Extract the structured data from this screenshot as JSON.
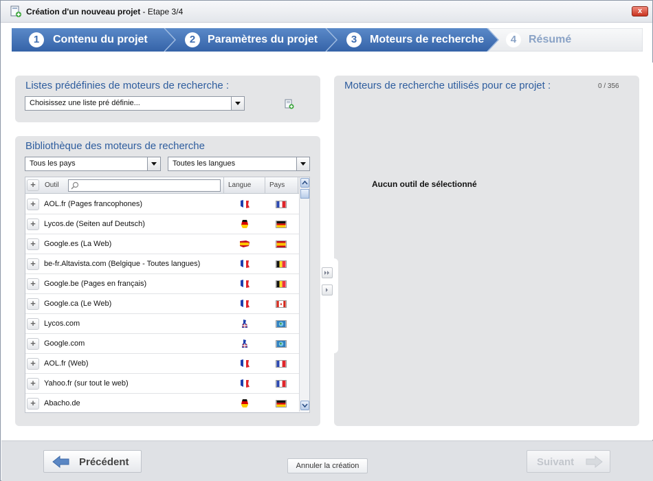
{
  "window": {
    "title_bold": "Création d'un nouveau projet",
    "title_rest": " - Etape 3/4",
    "close_label": "x"
  },
  "steps": [
    {
      "number": "1",
      "label": "Contenu du projet",
      "state": "done"
    },
    {
      "number": "2",
      "label": "Paramètres du projet",
      "state": "done"
    },
    {
      "number": "3",
      "label": "Moteurs de recherche",
      "state": "active"
    },
    {
      "number": "4",
      "label": "Résumé",
      "state": "pending"
    }
  ],
  "predefined": {
    "title": "Listes prédéfinies de moteurs de recherche :",
    "select_value": "Choisissez une liste pré définie...",
    "add_icon": "add-list-icon"
  },
  "library": {
    "title": "Bibliothèque des moteurs de recherche",
    "country_filter": "Tous les pays",
    "language_filter": "Toutes les langues",
    "columns": {
      "tool": "Outil",
      "language": "Langue",
      "country": "Pays"
    },
    "search_value": "",
    "rows": [
      {
        "name": "AOL.fr (Pages francophones)",
        "lang": "fr",
        "country": "fr"
      },
      {
        "name": "Lycos.de (Seiten auf Deutsch)",
        "lang": "de",
        "country": "de"
      },
      {
        "name": "Google.es (La Web)",
        "lang": "es",
        "country": "es"
      },
      {
        "name": "be-fr.Altavista.com (Belgique - Toutes langues)",
        "lang": "fr",
        "country": "be"
      },
      {
        "name": "Google.be (Pages en français)",
        "lang": "fr",
        "country": "be"
      },
      {
        "name": "Google.ca (Le Web)",
        "lang": "fr",
        "country": "ca"
      },
      {
        "name": "Lycos.com",
        "lang": "en",
        "country": "world"
      },
      {
        "name": "Google.com",
        "lang": "en",
        "country": "world"
      },
      {
        "name": "AOL.fr (Web)",
        "lang": "fr",
        "country": "fr"
      },
      {
        "name": "Yahoo.fr (sur tout le web)",
        "lang": "fr",
        "country": "fr"
      },
      {
        "name": "Abacho.de",
        "lang": "de",
        "country": "de"
      }
    ]
  },
  "used": {
    "title": "Moteurs de recherche utilisés pour ce projet :",
    "counter": "0 / 356",
    "empty_message": "Aucun outil de sélectionné"
  },
  "footer": {
    "previous": "Précédent",
    "cancel": "Annuler la création",
    "next": "Suivant"
  },
  "colors": {
    "step_active": "#3f6eb3",
    "step_pending": "#f0f1f3",
    "panel_title": "#2e5d9e"
  }
}
